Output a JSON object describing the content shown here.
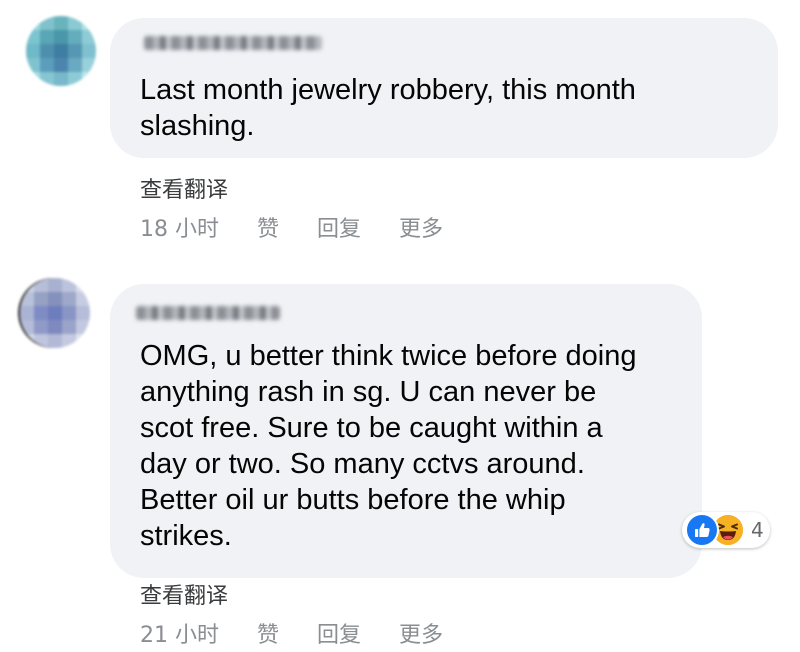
{
  "colors": {
    "bubble": "#f0f2f5",
    "text": "#050505",
    "meta": "#8a8d91",
    "like": "#1877f2",
    "haha": "#f7b125"
  },
  "comments": [
    {
      "text": "Last month jewelry robbery, this month\nslashing.",
      "translate": "查看翻译",
      "time": "18 小时",
      "actions": [
        "赞",
        "回复",
        "更多"
      ]
    },
    {
      "text": "OMG, u better think twice before doing\nanything rash in sg. U can never be\nscot free. Sure to be caught within a\nday or two. So many cctvs around.\nBetter oil ur butts before the whip\nstrikes.",
      "translate": "查看翻译",
      "time": "21 小时",
      "actions": [
        "赞",
        "回复",
        "更多"
      ],
      "reactions": {
        "icons": [
          "like-icon",
          "haha-icon"
        ],
        "count": "4"
      }
    }
  ]
}
